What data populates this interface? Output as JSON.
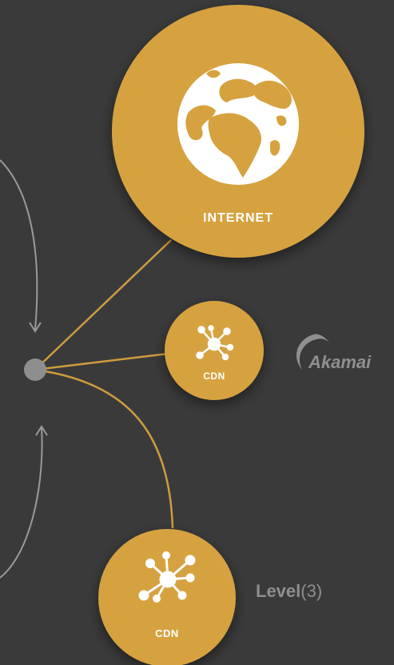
{
  "colors": {
    "background": "#3a3a3b",
    "node": "#d6a23f",
    "connector": "#cf9c3c",
    "hub": "#8e8e8f",
    "arrow": "#9a9a9a",
    "label": "#ffffff",
    "brand": "#8f8f90"
  },
  "nodes": {
    "internet": {
      "label": "INTERNET",
      "icon": "globe-icon"
    },
    "cdn_akamai": {
      "label": "CDN",
      "icon": "network-hub-icon"
    },
    "cdn_level3": {
      "label": "CDN",
      "icon": "network-hub-icon"
    }
  },
  "brands": {
    "akamai": {
      "name": "Akamai"
    },
    "level3": {
      "name": "Level",
      "suffix": "(3)"
    }
  }
}
